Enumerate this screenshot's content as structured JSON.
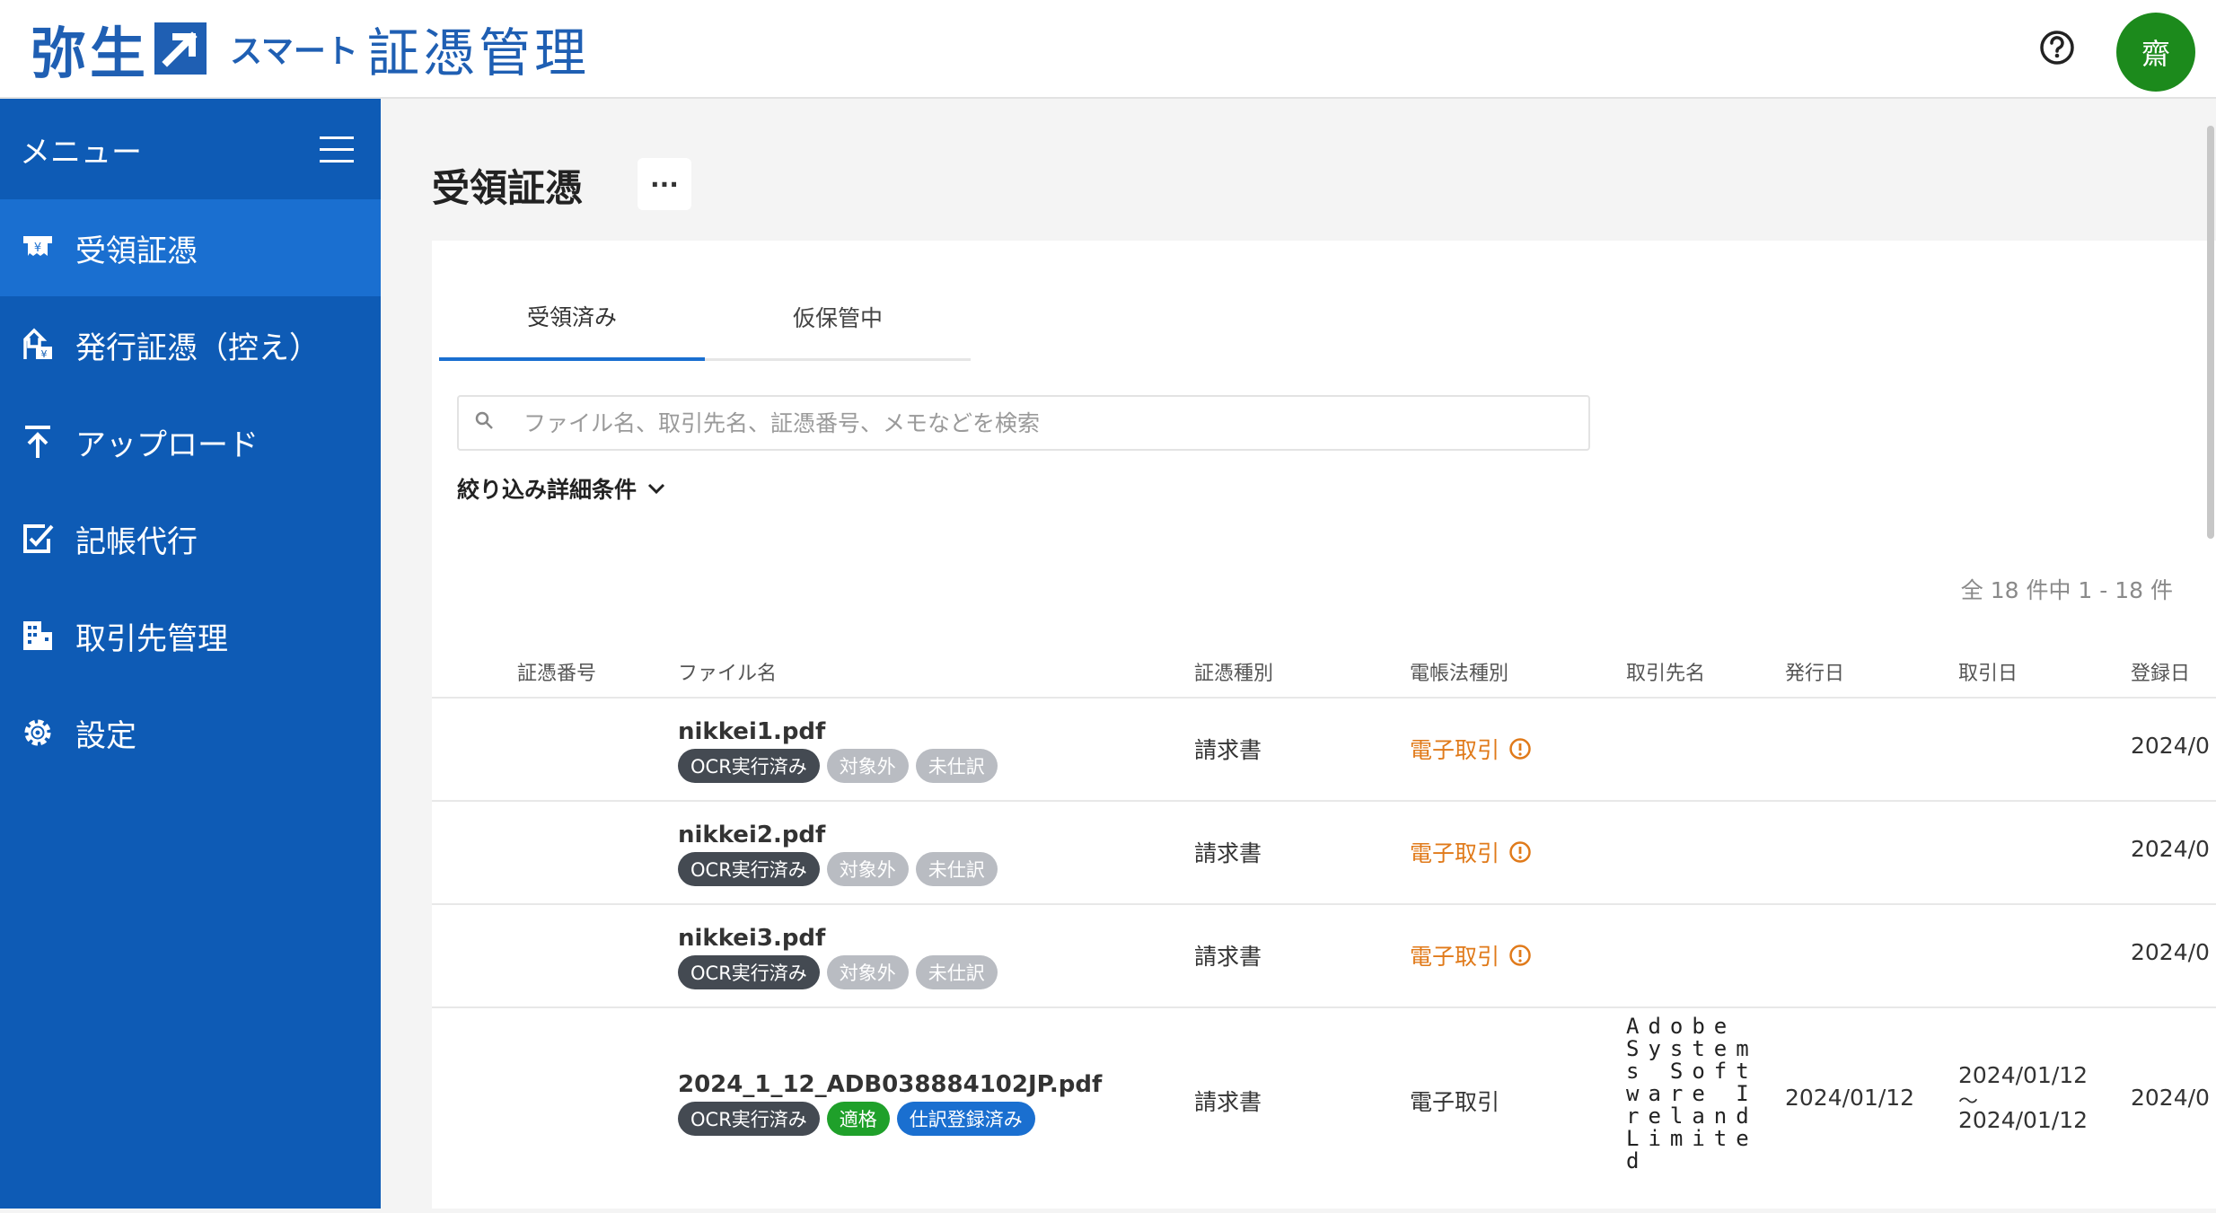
{
  "header": {
    "logo_text": "弥生",
    "logo_sub": "スマート",
    "logo_main": "証憑管理",
    "avatar_initial": "齋"
  },
  "sidebar": {
    "menu_label": "メニュー",
    "items": [
      {
        "label": "受領証憑",
        "icon": "receipt-icon",
        "active": true
      },
      {
        "label": "発行証憑（控え）",
        "icon": "upload-document-icon",
        "active": false
      },
      {
        "label": "アップロード",
        "icon": "upload-arrow-icon",
        "active": false
      },
      {
        "label": "記帳代行",
        "icon": "edit-check-icon",
        "active": false
      },
      {
        "label": "取引先管理",
        "icon": "building-icon",
        "active": false
      },
      {
        "label": "設定",
        "icon": "gear-icon",
        "active": false
      }
    ]
  },
  "main": {
    "title": "受領証憑",
    "more_label": "···",
    "tabs": [
      "受領済み",
      "仮保管中"
    ],
    "search_placeholder": "ファイル名、取引先名、証憑番号、メモなどを検索",
    "filter_label": "絞り込み詳細条件",
    "count_text": "全 18 件中 1 - 18 件",
    "columns": [
      "証憑番号",
      "ファイル名",
      "証憑種別",
      "電帳法種別",
      "取引先名",
      "発行日",
      "取引日",
      "登録日"
    ],
    "rows": [
      {
        "file": "nikkei1.pdf",
        "badges": [
          "OCR実行済み",
          "対象外",
          "未仕訳"
        ],
        "type": "請求書",
        "law": "電子取引",
        "registered": "2024/0"
      },
      {
        "file": "nikkei2.pdf",
        "badges": [
          "OCR実行済み",
          "対象外",
          "未仕訳"
        ],
        "type": "請求書",
        "law": "電子取引",
        "registered": "2024/0"
      },
      {
        "file": "nikkei3.pdf",
        "badges": [
          "OCR実行済み",
          "対象外",
          "未仕訳"
        ],
        "type": "請求書",
        "law": "電子取引",
        "registered": "2024/0"
      },
      {
        "file": "2024_1_12_ADB038884102JP.pdf",
        "badges": [
          "OCR実行済み",
          "適格",
          "仕訳登録済み"
        ],
        "type": "請求書",
        "law": "電子取引",
        "vendor": "Adobe Systems Software Ireland Limited",
        "issued": "2024/01/12",
        "txn_from": "2024/01/12",
        "txn_sep": "〜",
        "txn_to": "2024/01/12",
        "registered": "2024/0"
      }
    ]
  },
  "colors": {
    "brand": "#1f5fb3",
    "sidebar": "#0e5bb5",
    "sidebar_active": "#1a6fd0",
    "warning": "#e07a1a",
    "avatar": "#1c8a1c"
  }
}
